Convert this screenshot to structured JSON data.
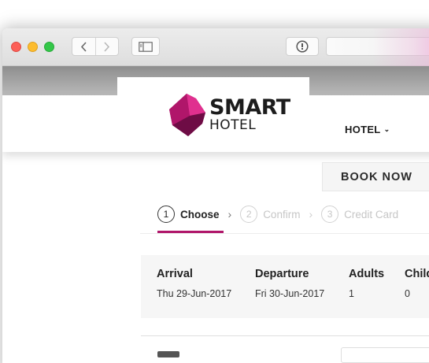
{
  "brand": {
    "logo_line1": "SMART",
    "logo_line2": "HOTEL",
    "logo_colors": {
      "light": "#e0308f",
      "mid": "#b0166a",
      "dark": "#6e0c45"
    }
  },
  "browser": {
    "controls": [
      "close-icon",
      "minimize-icon",
      "maximize-icon",
      "back-icon",
      "forward-icon",
      "sidebar-icon",
      "reader-icon"
    ]
  },
  "nav": {
    "hotel_label": "HOTEL",
    "hotel_chevron": "⌄"
  },
  "actions": {
    "book_now": "BOOK NOW"
  },
  "steps": [
    {
      "number": "1",
      "label": "Choose",
      "active": true
    },
    {
      "number": "2",
      "label": "Confirm",
      "active": false
    },
    {
      "number": "3",
      "label": "Credit Card",
      "active": false
    }
  ],
  "step_separator": "›",
  "summary": {
    "arrival": {
      "label": "Arrival",
      "value": "Thu 29-Jun-2017"
    },
    "departure": {
      "label": "Departure",
      "value": "Fri 30-Jun-2017"
    },
    "adults": {
      "label": "Adults",
      "value": "1"
    },
    "children": {
      "label": "Child",
      "value": "0"
    }
  },
  "colors": {
    "accent": "#b0166a",
    "inactive_step": "#c6c6c6"
  }
}
